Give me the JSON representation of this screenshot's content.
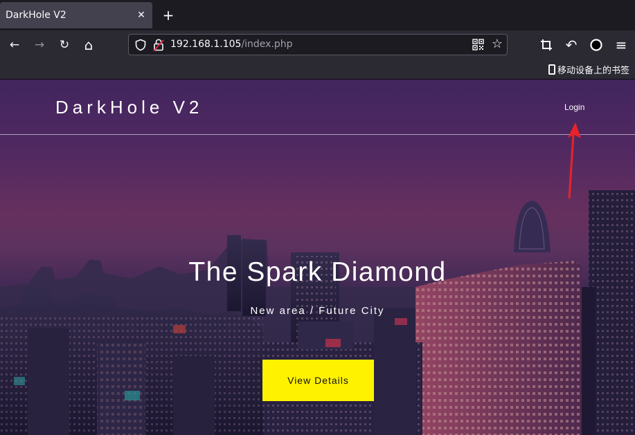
{
  "browser": {
    "tab_title": "DarkHole V2",
    "tab_close": "✕",
    "new_tab": "+",
    "url_host": "192.168.1.105",
    "url_path": "/index.php",
    "bookmark_mobile": "移动设备上的书签",
    "icons": {
      "back": "←",
      "forward": "→",
      "reload": "↻",
      "home": "⌂",
      "star": "☆",
      "undo": "↶",
      "menu": "≡"
    }
  },
  "site": {
    "logo": "DarkHole V2",
    "login": "Login",
    "hero_title": "The Spark Diamond",
    "hero_subtitle": "New area / Future City",
    "cta": "View Details"
  },
  "colors": {
    "accent_button": "#fff200",
    "annotation_arrow": "#e8232a"
  }
}
